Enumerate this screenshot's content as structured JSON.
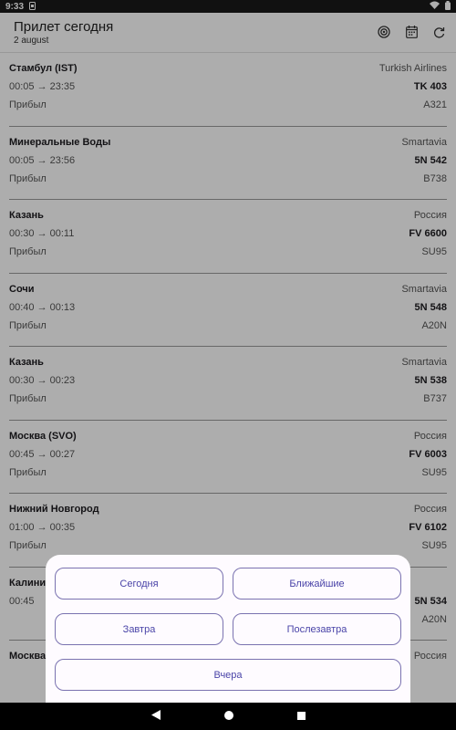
{
  "status_bar": {
    "time": "9:33"
  },
  "header": {
    "title": "Прилет сегодня",
    "subtitle": "2 august"
  },
  "flights": [
    {
      "city": "Стамбул (IST)",
      "airline": "Turkish Airlines",
      "times": "00:05 → 23:35",
      "number": "TK  403",
      "status": "Прибыл",
      "aircraft": "A321"
    },
    {
      "city": "Минеральные Воды",
      "airline": "Smartavia",
      "times": "00:05 → 23:56",
      "number": "5N  542",
      "status": "Прибыл",
      "aircraft": "B738"
    },
    {
      "city": "Казань",
      "airline": "Россия",
      "times": "00:30 → 00:11",
      "number": "FV 6600",
      "status": "Прибыл",
      "aircraft": "SU95"
    },
    {
      "city": "Сочи",
      "airline": "Smartavia",
      "times": "00:40 → 00:13",
      "number": "5N  548",
      "status": "Прибыл",
      "aircraft": "A20N"
    },
    {
      "city": "Казань",
      "airline": "Smartavia",
      "times": "00:30 → 00:23",
      "number": "5N  538",
      "status": "Прибыл",
      "aircraft": "B737"
    },
    {
      "city": "Москва (SVO)",
      "airline": "Россия",
      "times": "00:45 → 00:27",
      "number": "FV 6003",
      "status": "Прибыл",
      "aircraft": "SU95"
    },
    {
      "city": "Нижний Новгород",
      "airline": "Россия",
      "times": "01:00 → 00:35",
      "number": "FV 6102",
      "status": "Прибыл",
      "aircraft": "SU95"
    },
    {
      "city": "Калинин",
      "airline": "",
      "times": "00:45",
      "number": "5N  534",
      "status": "",
      "aircraft": "A20N"
    },
    {
      "city": "Москва",
      "airline": "Россия",
      "times": "",
      "number": "",
      "status": "",
      "aircraft": ""
    }
  ],
  "sheet": {
    "today": "Сегодня",
    "nearest": "Ближайшие",
    "tomorrow": "Завтра",
    "day_after": "Послезавтра",
    "yesterday": "Вчера"
  }
}
